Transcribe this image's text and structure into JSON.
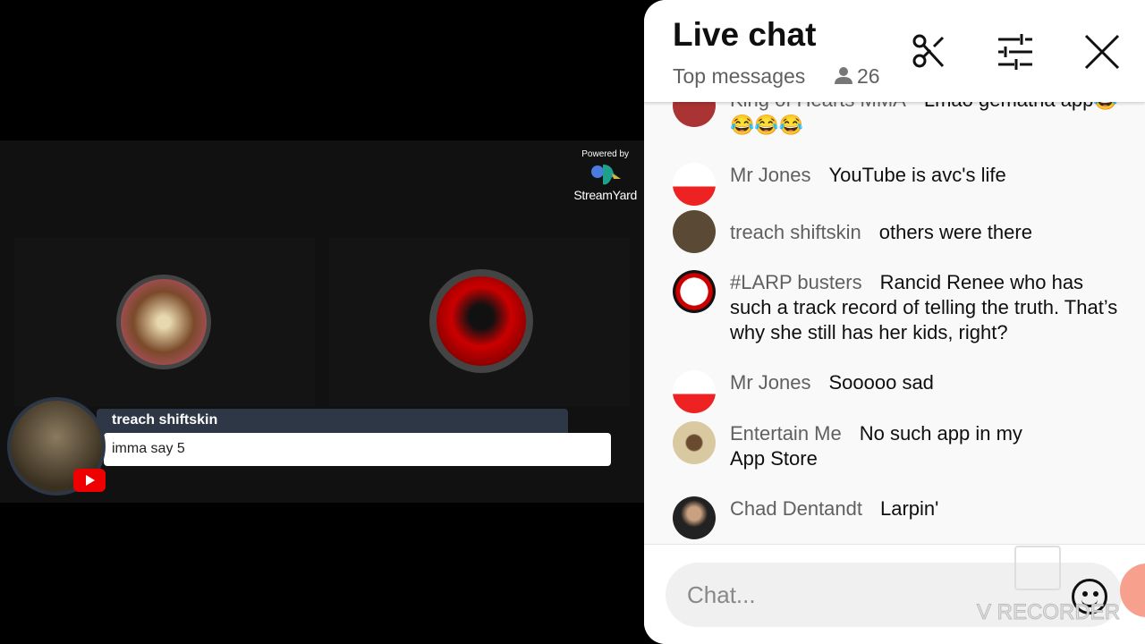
{
  "stream": {
    "powered_by": "Powered by",
    "brand": "StreamYard",
    "banner": {
      "name": "treach shiftskin",
      "message": "imma say 5",
      "platform_icon": "youtube-icon"
    }
  },
  "chat": {
    "title": "Live chat",
    "mode": "Top messages",
    "viewer_count": "26",
    "icons": [
      "scissors-icon",
      "tune-icon",
      "close-icon"
    ],
    "messages": [
      {
        "author": "King of Hearts MMA",
        "text": "Lmao gematria app😂😂😂😂",
        "avatar": "#a33"
      },
      {
        "author": "Mr Jones",
        "text": "YouTube is avc's life",
        "avatar": "#e33"
      },
      {
        "author": "treach shiftskin",
        "text": "others were there",
        "avatar": "#5a4a35"
      },
      {
        "author": "#LARP busters",
        "text": "Rancid Renee who has such a track record of telling the truth. That’s why she still has her kids, right?",
        "avatar": "#c00"
      },
      {
        "author": "Mr Jones",
        "text": "Sooooo sad",
        "avatar": "#e33"
      },
      {
        "author": "Entertain Me",
        "text": "No such app in my App Store",
        "avatar": "#c9b58f"
      },
      {
        "author": "Chad Dentandt",
        "text": "Larpin'",
        "avatar": "#333"
      }
    ],
    "input_placeholder": "Chat..."
  },
  "overlay": {
    "watermark": "V RECORDER"
  }
}
